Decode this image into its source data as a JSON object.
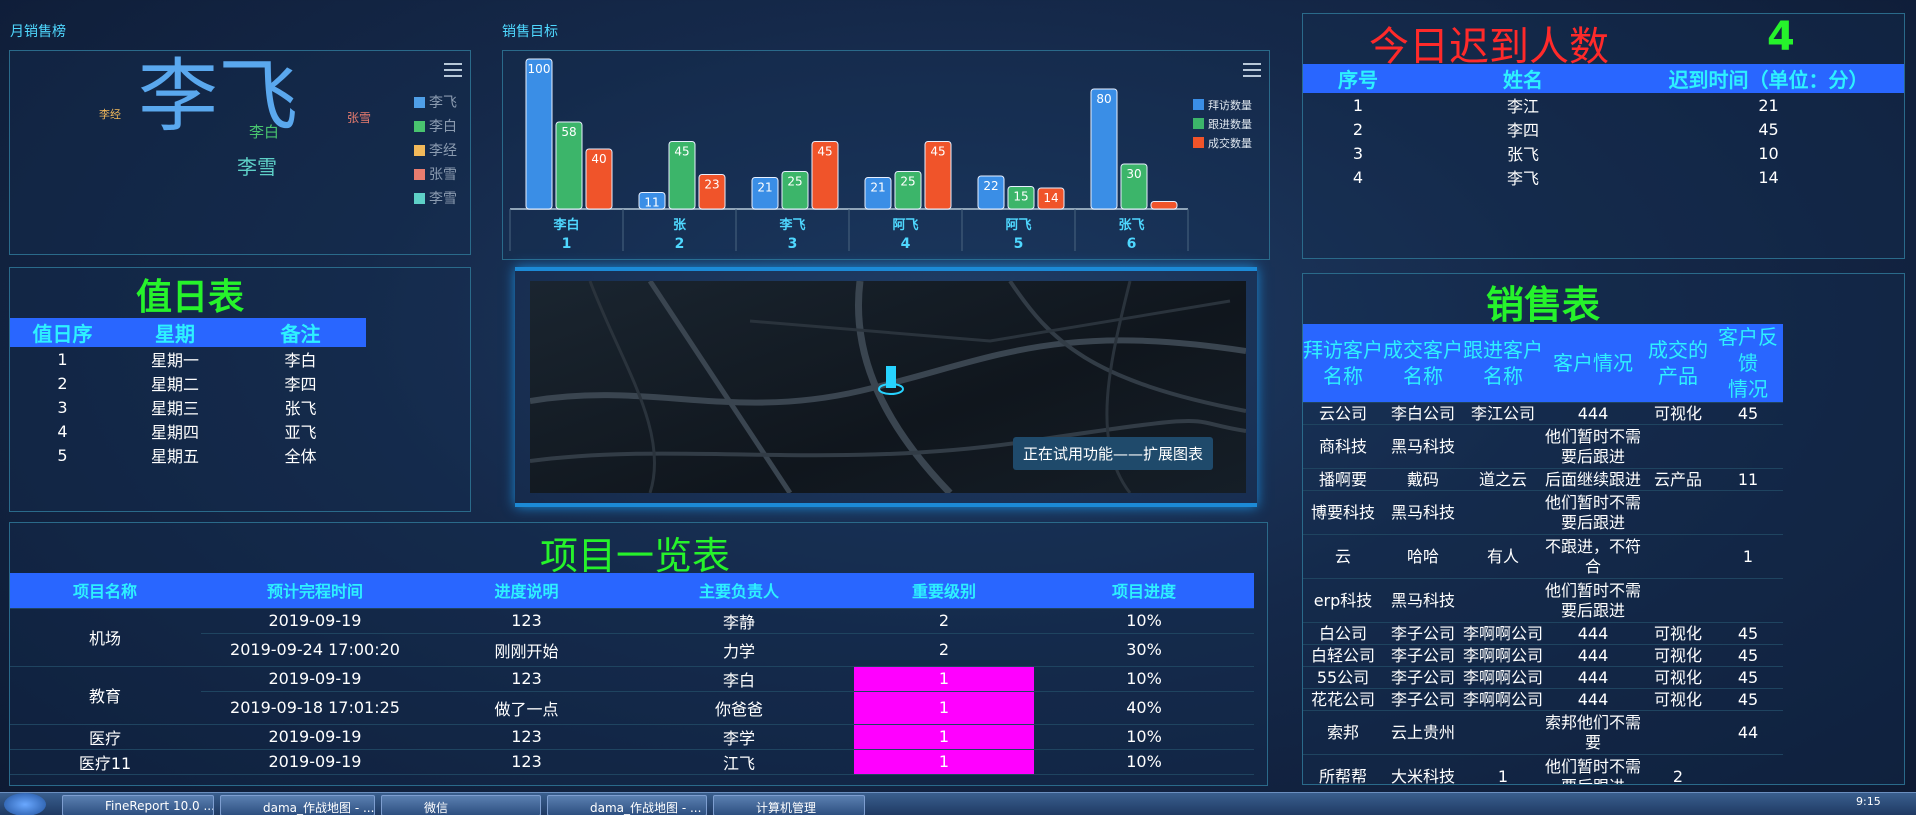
{
  "monthly_ranking": {
    "title": "月销售榜",
    "words": [
      "李经",
      "李飞",
      "李白",
      "李雪",
      "张雪"
    ],
    "legend": [
      "李飞",
      "李白",
      "李经",
      "张雪",
      "李雪"
    ],
    "legend_colors": [
      "#4f9fe8",
      "#49c46f",
      "#f2b95a",
      "#e87c6f",
      "#5ed0c7"
    ]
  },
  "sales_target": {
    "title": "销售目标",
    "legend": [
      "拜访数量",
      "跟进数量",
      "成交数量"
    ],
    "colors": [
      "#3a8ee6",
      "#3cb56a",
      "#f0542a"
    ],
    "chart_data": {
      "type": "bar",
      "categories": [
        "李白\n1",
        "张\n2",
        "李飞\n3",
        "阿飞\n4",
        "阿飞\n5",
        "张飞\n6"
      ],
      "category_names": [
        "李白",
        "张",
        "李飞",
        "阿飞",
        "阿飞",
        "张飞"
      ],
      "category_ids": [
        "1",
        "2",
        "3",
        "4",
        "5",
        "6"
      ],
      "series": [
        {
          "name": "拜访数量",
          "values": [
            100,
            11,
            21,
            21,
            22,
            80
          ]
        },
        {
          "name": "跟进数量",
          "values": [
            58,
            45,
            25,
            25,
            15,
            30
          ]
        },
        {
          "name": "成交数量",
          "values": [
            40,
            23,
            45,
            45,
            14,
            5
          ]
        }
      ]
    }
  },
  "late": {
    "title": "今日迟到人数",
    "count": "4",
    "headers": [
      "序号",
      "姓名",
      "迟到时间（单位：分）"
    ],
    "rows": [
      [
        "1",
        "李江",
        "21"
      ],
      [
        "2",
        "李四",
        "45"
      ],
      [
        "3",
        "张飞",
        "10"
      ],
      [
        "4",
        "李飞",
        "14"
      ]
    ]
  },
  "duty": {
    "title": "值日表",
    "headers": [
      "值日序",
      "星期",
      "备注"
    ],
    "rows": [
      [
        "1",
        "星期一",
        "李白"
      ],
      [
        "2",
        "星期二",
        "李四"
      ],
      [
        "3",
        "星期三",
        "张飞"
      ],
      [
        "4",
        "星期四",
        "亚飞"
      ],
      [
        "5",
        "星期五",
        "全体"
      ]
    ]
  },
  "map": {
    "trial_label": "正在试用功能——扩展图表"
  },
  "sales": {
    "title": "销售表",
    "headers": [
      "拜访客户\n名称",
      "成交客户\n名称",
      "跟进客户\n名称",
      "客户情况",
      "成交的\n产品",
      "客户反馈\n情况"
    ],
    "rows": [
      [
        "云公司",
        "李白公司",
        "李江公司",
        "444",
        "可视化",
        "45"
      ],
      [
        "商科技",
        "黑马科技",
        "",
        "他们暂时不需\n要后跟进",
        "",
        ""
      ],
      [
        "播啊要",
        "戴码",
        "道之云",
        "后面继续跟进",
        "云产品",
        "11"
      ],
      [
        "博要科技",
        "黑马科技",
        "",
        "他们暂时不需\n要后跟进",
        "",
        ""
      ],
      [
        "云",
        "哈哈",
        "有人",
        "不跟进，不符\n合",
        "",
        "1"
      ],
      [
        "erp科技",
        "黑马科技",
        "",
        "他们暂时不需\n要后跟进",
        "",
        ""
      ],
      [
        "白公司",
        "李子公司",
        "李啊啊公司",
        "444",
        "可视化",
        "45"
      ],
      [
        "白轻公司",
        "李子公司",
        "李啊啊公司",
        "444",
        "可视化",
        "45"
      ],
      [
        "55公司",
        "李子公司",
        "李啊啊公司",
        "444",
        "可视化",
        "45"
      ],
      [
        "花花公司",
        "李子公司",
        "李啊啊公司",
        "444",
        "可视化",
        "45"
      ],
      [
        "索邦",
        "云上贵州",
        "",
        "索邦他们不需\n要",
        "",
        "44"
      ],
      [
        "所帮帮",
        "大米科技",
        "1",
        "他们暂时不需\n要后跟进",
        "2",
        ""
      ]
    ]
  },
  "projects": {
    "title": "项目一览表",
    "headers": [
      "项目名称",
      "预计完程时间",
      "进度说明",
      "主要负责人",
      "重要级别",
      "项目进度"
    ],
    "groups": [
      {
        "name": "机场",
        "rows": [
          [
            "2019-09-19",
            "123",
            "李静",
            "2",
            "10%"
          ],
          [
            "2019-09-24 17:00:20",
            "刚刚开始",
            "力学",
            "2",
            "30%"
          ]
        ]
      },
      {
        "name": "教育",
        "rows": [
          [
            "2019-09-19",
            "123",
            "李白",
            "1",
            "10%"
          ],
          [
            "2019-09-18 17:01:25",
            "做了一点",
            "你爸爸",
            "1",
            "40%"
          ]
        ]
      },
      {
        "name": "医疗",
        "rows": [
          [
            "2019-09-19",
            "123",
            "李学",
            "1",
            "10%"
          ]
        ]
      },
      {
        "name": "医疗11",
        "rows": [
          [
            "2019-09-19",
            "123",
            "江飞",
            "1",
            "10%"
          ]
        ]
      }
    ]
  },
  "taskbar": {
    "items": [
      "FineReport 10.0 ...",
      "dama_作战地图 - ...",
      "微信",
      "dama_作战地图 - ...",
      "计算机管理"
    ],
    "clock": "9:15"
  }
}
